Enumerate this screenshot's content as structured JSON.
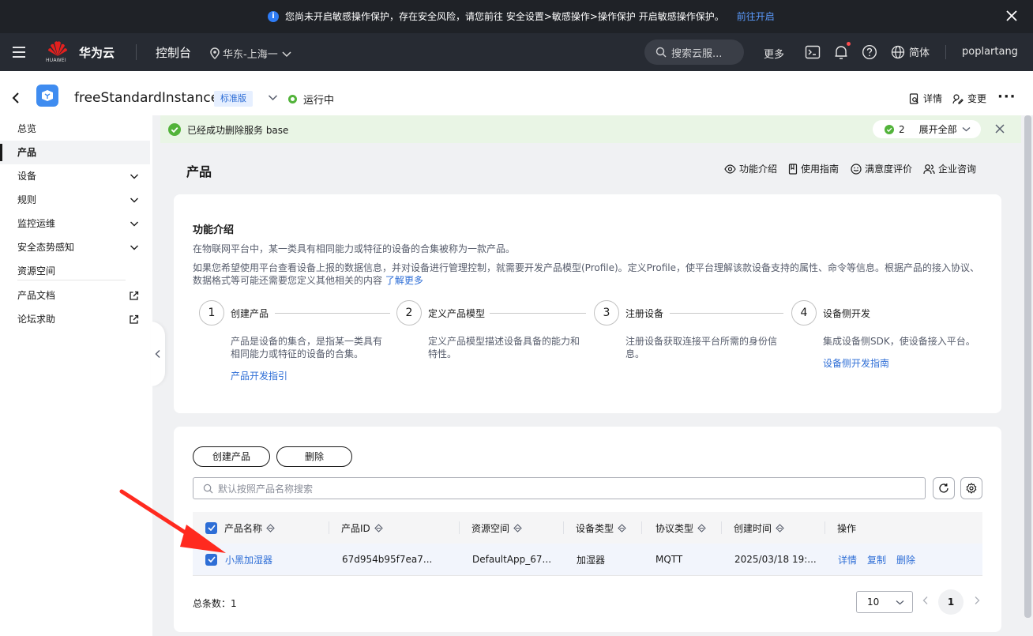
{
  "notice": {
    "message": "您尚未开启敏感操作保护，存在安全风险，请您前往 安全设置>敏感操作>操作保护 开启敏感操作保护。",
    "link": "前往开启"
  },
  "nav": {
    "logo_text": "HUAWEI",
    "brand": "华为云",
    "console": "控制台",
    "region": "华东-上海一",
    "search_placeholder": "搜索云服...",
    "more": "更多",
    "lang": "简体",
    "user": "poplartang"
  },
  "instance": {
    "name": "freeStandardInstance",
    "edition_tag": "标准版",
    "status": "运行中",
    "details": "详情",
    "change": "变更",
    "more": "···"
  },
  "sidebar": {
    "items": [
      {
        "label": "总览",
        "expandable": false
      },
      {
        "label": "产品",
        "expandable": false,
        "active": true
      },
      {
        "label": "设备",
        "expandable": true
      },
      {
        "label": "规则",
        "expandable": true
      },
      {
        "label": "监控运维",
        "expandable": true
      },
      {
        "label": "安全态势感知",
        "expandable": true
      },
      {
        "label": "资源空间",
        "expandable": false
      },
      {
        "label": "产品文档",
        "external": true
      },
      {
        "label": "论坛求助",
        "external": true
      }
    ]
  },
  "banner": {
    "message": "已经成功删除服务 base",
    "count": "2",
    "expand_all": "展开全部"
  },
  "page": {
    "title": "产品",
    "tools": [
      "功能介绍",
      "使用指南",
      "满意度评价",
      "企业咨询"
    ]
  },
  "intro": {
    "heading": "功能介绍",
    "p1": "在物联网平台中，某一类具有相同能力或特征的设备的合集被称为一款产品。",
    "p2": "如果您希望使用平台查看设备上报的数据信息，并对设备进行管理控制，就需要开发产品模型(Profile)。定义Profile，使平台理解该款设备支持的属性、命令等信息。根据产品的接入协议、",
    "p3": "数据格式等可能还需要您定义其他相关的内容",
    "learn_more": "了解更多",
    "steps": [
      {
        "num": "1",
        "title": "创建产品",
        "desc": "产品是设备的集合，是指某一类具有相同能力或特征的设备的合集。",
        "link": "产品开发指引"
      },
      {
        "num": "2",
        "title": "定义产品模型",
        "desc": "定义产品模型描述设备具备的能力和特性。",
        "link": ""
      },
      {
        "num": "3",
        "title": "注册设备",
        "desc": "注册设备获取连接平台所需的身份信息。",
        "link": ""
      },
      {
        "num": "4",
        "title": "设备侧开发",
        "desc": "集成设备侧SDK，使设备接入平台。",
        "link": "设备侧开发指南"
      }
    ]
  },
  "products": {
    "create_button": "创建产品",
    "delete_button": "删除",
    "search_placeholder": "默认按照产品名称搜索",
    "columns": [
      "产品名称",
      "产品ID",
      "资源空间",
      "设备类型",
      "协议类型",
      "创建时间",
      "操作"
    ],
    "rows": [
      {
        "name": "小黑加湿器",
        "id": "67d954b95f7ea7...",
        "space": "DefaultApp_67...",
        "device_type": "加湿器",
        "protocol": "MQTT",
        "created": "2025/03/18 19:...",
        "actions": [
          "详情",
          "复制",
          "删除"
        ]
      }
    ],
    "total_label": "总条数：1",
    "page_size": "10",
    "current_page": "1"
  },
  "colors": {
    "accent": "#2e6ed6",
    "nav_bg": "#272b33",
    "success": "#52b33a",
    "arrow": "#ff2a1f"
  }
}
